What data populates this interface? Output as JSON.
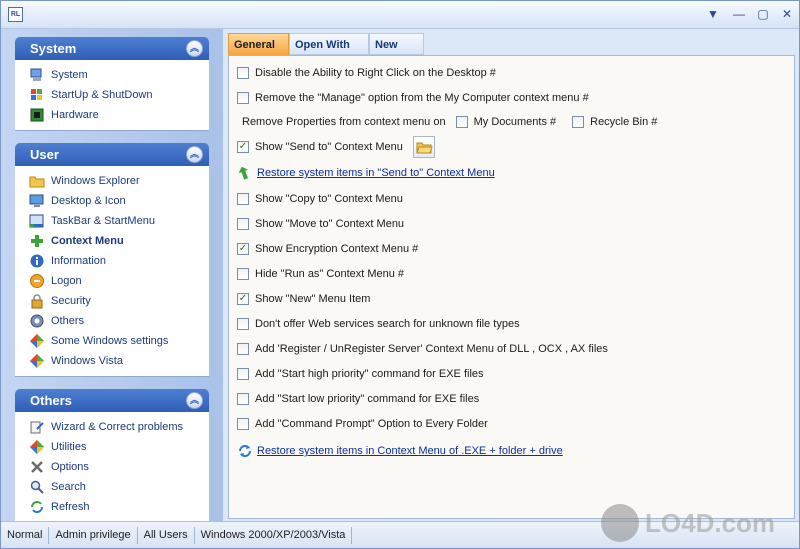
{
  "app": {
    "icon_text": "RL"
  },
  "titlebar": {
    "menu_glyph": "▼",
    "min_glyph": "—",
    "max_glyph": "▢",
    "close_glyph": "✕"
  },
  "sidebar": {
    "groups": [
      {
        "title": "System",
        "items": [
          {
            "label": "System",
            "icon": "computer-icon"
          },
          {
            "label": "StartUp & ShutDown",
            "icon": "windows-flag-icon"
          },
          {
            "label": "Hardware",
            "icon": "chip-icon"
          }
        ]
      },
      {
        "title": "User",
        "items": [
          {
            "label": "Windows Explorer",
            "icon": "folder-icon"
          },
          {
            "label": "Desktop & Icon",
            "icon": "desktop-icon"
          },
          {
            "label": "TaskBar & StartMenu",
            "icon": "taskbar-icon"
          },
          {
            "label": "Context Menu",
            "icon": "plus-icon",
            "active": true
          },
          {
            "label": "Information",
            "icon": "info-icon"
          },
          {
            "label": "Logon",
            "icon": "logon-icon"
          },
          {
            "label": "Security",
            "icon": "lock-icon"
          },
          {
            "label": "Others",
            "icon": "gear-icon"
          },
          {
            "label": "Some Windows settings",
            "icon": "diamond-icon"
          },
          {
            "label": "Windows Vista",
            "icon": "windows-flag-icon"
          }
        ]
      },
      {
        "title": "Others",
        "items": [
          {
            "label": "Wizard & Correct problems",
            "icon": "wand-icon"
          },
          {
            "label": "Utilities",
            "icon": "diamond-icon"
          },
          {
            "label": "Options",
            "icon": "tools-icon"
          },
          {
            "label": "Search",
            "icon": "search-icon"
          },
          {
            "label": "Refresh",
            "icon": "refresh-icon"
          }
        ]
      }
    ]
  },
  "tabs": [
    {
      "label": "General",
      "active": true
    },
    {
      "label": "Open With",
      "active": false
    },
    {
      "label": "New",
      "active": false
    }
  ],
  "general": {
    "opt1": {
      "label": "Disable the Ability to Right Click on the Desktop #",
      "checked": false
    },
    "opt2": {
      "label": "Remove the \"Manage\" option from the My Computer context menu #",
      "checked": false
    },
    "remove_props_label": "Remove Properties from context menu on",
    "my_documents": {
      "label": "My Documents #",
      "checked": false
    },
    "recycle_bin": {
      "label": "Recycle Bin #",
      "checked": false
    },
    "send_to": {
      "label": "Show \"Send to\" Context Menu",
      "checked": true
    },
    "restore_send_to": "Restore system items in \"Send to\" Context Menu",
    "copy_to": {
      "label": "Show \"Copy to\" Context Menu",
      "checked": false
    },
    "move_to": {
      "label": "Show \"Move to\" Context Menu",
      "checked": false
    },
    "encryption": {
      "label": "Show Encryption Context Menu #",
      "checked": true
    },
    "run_as": {
      "label": "Hide \"Run as\" Context Menu #",
      "checked": false
    },
    "new_item": {
      "label": "Show \"New\" Menu Item",
      "checked": true
    },
    "web_services": {
      "label": "Don't offer Web services search for unknown file types",
      "checked": false
    },
    "register": {
      "label": "Add 'Register / UnRegister Server' Context Menu of DLL , OCX , AX files",
      "checked": false
    },
    "high_priority": {
      "label": "Add \"Start high priority\" command for EXE files",
      "checked": false
    },
    "low_priority": {
      "label": "Add \"Start low priority\" command for EXE files",
      "checked": false
    },
    "cmd_prompt": {
      "label": "Add \"Command Prompt\" Option to Every Folder",
      "checked": false
    },
    "restore_exe": "Restore system items in Context Menu of .EXE + folder + drive"
  },
  "statusbar": {
    "mode": "Normal",
    "privilege": "Admin privilege",
    "users": "All Users",
    "os": "Windows 2000/XP/2003/Vista"
  },
  "watermark": {
    "text": "LO4D.com"
  }
}
